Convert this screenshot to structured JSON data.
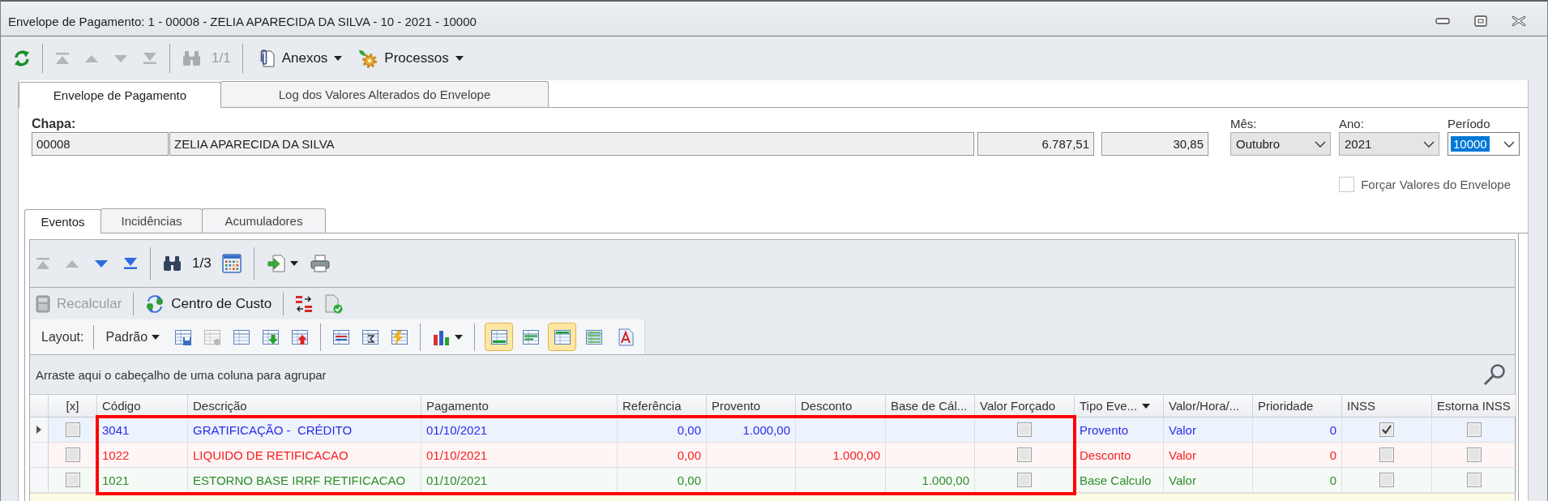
{
  "window": {
    "title": "Envelope de Pagamento: 1 - 00008 - ZELIA APARECIDA DA SILVA - 10 - 2021 - 10000"
  },
  "toolbar": {
    "nav_buttons": [
      {
        "disabled": true
      },
      {
        "disabled": true
      },
      {
        "disabled": true
      },
      {
        "disabled": true
      }
    ],
    "find": {
      "disabled": true,
      "counter": "1/1"
    },
    "menus": [
      {
        "label": "Anexos"
      },
      {
        "label": "Processos"
      }
    ]
  },
  "tabs": [
    {
      "label": "Envelope de Pagamento",
      "selected": true
    },
    {
      "label": "Log dos Valores Alterados do Envelope",
      "selected": false
    }
  ],
  "employee": {
    "label": "Chapa:",
    "fields": [
      {
        "kind": "text",
        "value": "00008"
      },
      {
        "kind": "text",
        "value": "ZELIA APARECIDA DA SILVA"
      },
      {
        "kind": "number",
        "value": "6.787,51"
      },
      {
        "kind": "number",
        "value": "30,85"
      }
    ]
  },
  "selects": [
    {
      "label": "Mês:",
      "value": "Outubro",
      "kind": "list",
      "text_selected": false
    },
    {
      "label": "Ano:",
      "value": "2021",
      "kind": "list",
      "text_selected": false
    },
    {
      "label": "Período",
      "value": "10000",
      "kind": "combo",
      "text_selected": true
    }
  ],
  "force_values": {
    "label": "Forçar Valores do Envelope",
    "checked": false
  },
  "inner_tabs": [
    {
      "label": "Eventos",
      "selected": true
    },
    {
      "label": "Incidências",
      "selected": false
    },
    {
      "label": "Acumuladores",
      "selected": false
    }
  ],
  "grid_toolbar": {
    "nav_buttons": [
      {
        "disabled": true
      },
      {
        "disabled": true
      },
      {
        "disabled": false
      },
      {
        "disabled": false
      }
    ],
    "find": {
      "disabled": false,
      "counter": "1/3"
    }
  },
  "action_bar": {
    "buttons": [
      {
        "label": "Recalcular",
        "disabled": true
      },
      {
        "label": "Centro de Custo",
        "disabled": false
      }
    ]
  },
  "layout_bar": {
    "label": "Layout:",
    "preset": "Padrão",
    "layout_buttons": [
      {
        "disabled": false
      },
      {
        "disabled": true
      },
      {
        "disabled": false
      },
      {
        "disabled": false
      },
      {
        "disabled": false
      }
    ],
    "view_buttons": [
      {
        "selected": true
      },
      {
        "selected": false
      },
      {
        "selected": true
      },
      {
        "selected": false
      },
      {
        "selected": false
      }
    ]
  },
  "group_panel": {
    "hint": "Arraste aqui o cabeçalho de uma coluna para agrupar"
  },
  "table": {
    "columns": [
      {
        "label": "[x]",
        "filter_button": false
      },
      {
        "label": "Código",
        "filter_button": false
      },
      {
        "label": "Descrição",
        "filter_button": false
      },
      {
        "label": "Pagamento",
        "filter_button": false
      },
      {
        "label": "Referência",
        "filter_button": false
      },
      {
        "label": "Provento",
        "filter_button": false
      },
      {
        "label": "Desconto",
        "filter_button": false
      },
      {
        "label": "Base de Cál...",
        "filter_button": false
      },
      {
        "label": "Valor Forçado",
        "filter_button": false
      },
      {
        "label": "Tipo Eve...",
        "filter_button": true
      },
      {
        "label": "Valor/Hora/...",
        "filter_button": false
      },
      {
        "label": "Prioridade",
        "filter_button": false
      },
      {
        "label": "INSS",
        "filter_button": false
      },
      {
        "label": "Estorna INSS",
        "filter_button": false
      }
    ],
    "rows": [
      {
        "selected": true,
        "color": "#2b2bec",
        "cells": [
          {
            "kind": "check",
            "checked": false
          },
          {
            "kind": "text",
            "text": "3041"
          },
          {
            "kind": "text",
            "text": "GRATIFICAÇÃO -  CRÉDITO"
          },
          {
            "kind": "text",
            "text": "01/10/2021"
          },
          {
            "kind": "number",
            "text": "0,00"
          },
          {
            "kind": "number",
            "text": "1.000,00"
          },
          null,
          null,
          {
            "kind": "check",
            "checked": false
          },
          {
            "kind": "text",
            "text": "Provento"
          },
          {
            "kind": "text",
            "text": "Valor"
          },
          {
            "kind": "number",
            "text": "0"
          },
          {
            "kind": "check",
            "checked": true
          },
          {
            "kind": "check",
            "checked": false
          }
        ]
      },
      {
        "selected": false,
        "color": "#f52020",
        "cells": [
          {
            "kind": "check",
            "checked": false
          },
          {
            "kind": "text",
            "text": "1022"
          },
          {
            "kind": "text",
            "text": "LIQUIDO DE RETIFICACAO"
          },
          {
            "kind": "text",
            "text": "01/10/2021"
          },
          {
            "kind": "number",
            "text": "0,00"
          },
          null,
          {
            "kind": "number",
            "text": "1.000,00"
          },
          null,
          {
            "kind": "check",
            "checked": false
          },
          {
            "kind": "text",
            "text": "Desconto"
          },
          {
            "kind": "text",
            "text": "Valor"
          },
          {
            "kind": "number",
            "text": "0"
          },
          {
            "kind": "check",
            "checked": false
          },
          {
            "kind": "check",
            "checked": false
          }
        ]
      },
      {
        "selected": false,
        "color": "#2e8b2e",
        "cells": [
          {
            "kind": "check",
            "checked": false
          },
          {
            "kind": "text",
            "text": "1021"
          },
          {
            "kind": "text",
            "text": "ESTORNO BASE IRRF RETIFICACAO"
          },
          {
            "kind": "text",
            "text": "01/10/2021"
          },
          {
            "kind": "number",
            "text": "0,00"
          },
          null,
          null,
          {
            "kind": "number",
            "text": "1.000,00"
          },
          {
            "kind": "check",
            "checked": false
          },
          {
            "kind": "text",
            "text": "Base Calculo"
          },
          {
            "kind": "text",
            "text": "Valor"
          },
          {
            "kind": "number",
            "text": "0"
          },
          {
            "kind": "check",
            "checked": false
          },
          {
            "kind": "check",
            "checked": false
          }
        ]
      }
    ]
  },
  "annotation": {
    "kind": "frame"
  }
}
